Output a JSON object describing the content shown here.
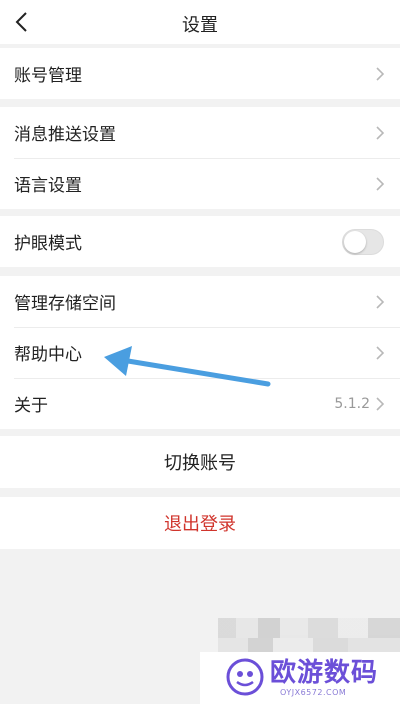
{
  "header": {
    "title": "设置"
  },
  "groups": {
    "account": {
      "label": "账号管理"
    },
    "push": {
      "label": "消息推送设置"
    },
    "language": {
      "label": "语言设置"
    },
    "eye": {
      "label": "护眼模式",
      "enabled": false
    },
    "storage": {
      "label": "管理存储空间"
    },
    "help": {
      "label": "帮助中心"
    },
    "about": {
      "label": "关于",
      "version": "5.1.2"
    }
  },
  "actions": {
    "switch_account": "切换账号",
    "logout": "退出登录"
  },
  "colors": {
    "logout_text": "#d0342c",
    "arrow": "#4a9ee0",
    "watermark": "#6b4fd8"
  },
  "watermark": {
    "name": "欧游数码",
    "url": "OYJX6572.COM"
  }
}
